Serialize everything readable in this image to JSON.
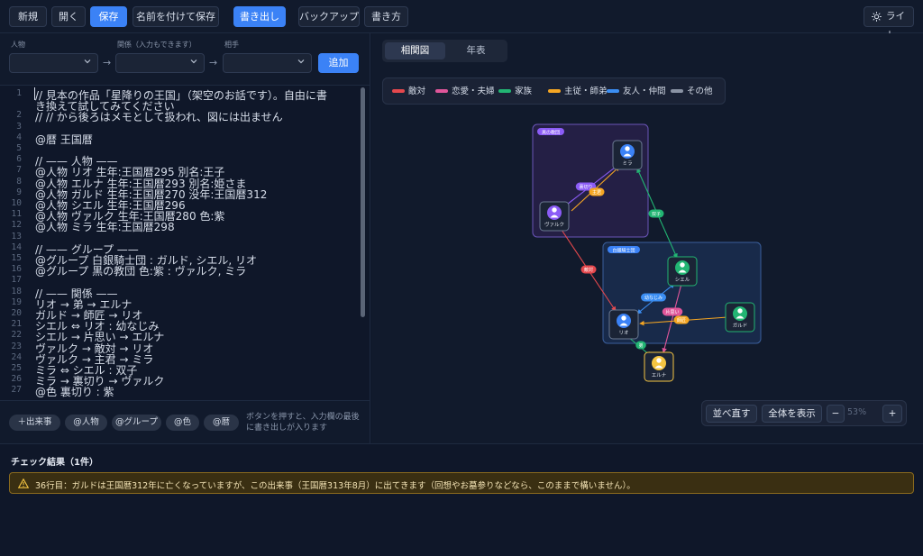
{
  "toolbar": {
    "new": "新規",
    "open": "開く",
    "save": "保存",
    "save_as": "名前を付けて保存",
    "export": "書き出し",
    "backup": "バックアップ",
    "syntax": "書き方",
    "theme": "ライト"
  },
  "form": {
    "person_label": "人物",
    "relation_label": "関係（入力もできます）",
    "partner_label": "相手",
    "add_button": "追加",
    "arrow": "→"
  },
  "editor": {
    "lines": [
      "// 見本の作品「星降りの王国」（架空のお話です）。自由に書",
      "き換えて試してみてください",
      "// // から後ろはメモとして扱われ、図には出ません",
      "",
      "@暦 王国暦",
      "",
      "// —— 人物 ——",
      "@人物 リオ 生年:王国暦295 別名:王子",
      "@人物 エルナ 生年:王国暦293 別名:姫さま",
      "@人物 ガルド 生年:王国暦270 没年:王国暦312",
      "@人物 シエル 生年:王国暦296",
      "@人物 ヴァルク 生年:王国暦280 色:紫",
      "@人物 ミラ 生年:王国暦298",
      "",
      "// —— グループ ——",
      "@グループ 白銀騎士団 : ガルド, シエル, リオ",
      "@グループ 黒の教団 色:紫 : ヴァルク, ミラ",
      "",
      "// —— 関係 ——",
      "リオ → 弟 → エルナ",
      "ガルド → 師匠 → リオ",
      "シエル ⇔ リオ : 幼なじみ",
      "シエル → 片思い → エルナ",
      "ヴァルク → 敵対 → リオ",
      "ヴァルク → 主君 → ミラ",
      "ミラ ⇔ シエル : 双子",
      "ミラ → 裏切り → ヴァルク",
      "@色 裏切り : 紫"
    ],
    "line_numbers": [
      "1",
      "",
      "2",
      "3",
      "4",
      "5",
      "6",
      "7",
      "8",
      "9",
      "10",
      "11",
      "12",
      "13",
      "14",
      "15",
      "16",
      "17",
      "18",
      "19",
      "20",
      "21",
      "22",
      "23",
      "24",
      "25",
      "26",
      "27",
      "28"
    ]
  },
  "snippets": {
    "event": "＋出来事",
    "person": "@人物",
    "group": "@グループ",
    "color": "@色",
    "calendar": "@暦",
    "hint": "ボタンを押すと、入力欄の最後に書き出しが入ります"
  },
  "view_tabs": {
    "diagram": "相関図",
    "timeline": "年表"
  },
  "legend": [
    {
      "label": "敵対",
      "color": "#e5484d"
    },
    {
      "label": "恋愛・夫婦",
      "color": "#e0569a"
    },
    {
      "label": "家族",
      "color": "#22b573"
    },
    {
      "label": "主従・師弟",
      "color": "#f5a623"
    },
    {
      "label": "友人・仲間",
      "color": "#3b8ef3"
    },
    {
      "label": "その他",
      "color": "#8a93a4"
    }
  ],
  "graph": {
    "groups": [
      {
        "label": "黒の教団",
        "color": "#8b5cf6"
      },
      {
        "label": "白銀騎士団",
        "color": "#3b82f6"
      }
    ],
    "nodes": [
      {
        "label": "ミラ",
        "avatar_color": "#3b82f6",
        "border": "#6b7a93"
      },
      {
        "label": "ヴァルク",
        "avatar_color": "#8b5cf6",
        "border": "#6b7a93"
      },
      {
        "label": "シエル",
        "avatar_color": "#22b573",
        "border": "#22b573"
      },
      {
        "label": "リオ",
        "avatar_color": "#3b82f6",
        "border": "#6b7a93"
      },
      {
        "label": "ガルド",
        "avatar_color": "#22b573",
        "border": "#22b573"
      },
      {
        "label": "エルナ",
        "avatar_color": "#f5c542",
        "border": "#f5c542"
      }
    ],
    "edge_labels": [
      {
        "text": "裏切り",
        "color": "#8b5cf6"
      },
      {
        "text": "主君",
        "color": "#f5a623"
      },
      {
        "text": "双子",
        "color": "#22b573"
      },
      {
        "text": "敵対",
        "color": "#e5484d"
      },
      {
        "text": "幼なじみ",
        "color": "#3b8ef3"
      },
      {
        "text": "片思い",
        "color": "#e0569a"
      },
      {
        "text": "師匠",
        "color": "#f5a623"
      },
      {
        "text": "弟",
        "color": "#22b573"
      }
    ]
  },
  "zoom": {
    "relayout": "並べ直す",
    "fit": "全体を表示",
    "minus": "−",
    "percent": "53%",
    "plus": "+"
  },
  "check": {
    "title": "チェック結果（1件）",
    "warning": "36行目：ガルドは王国暦312年に亡くなっていますが、この出来事（王国暦313年8月）に出てきます（回想やお墓参りなどなら、このままで構いません）。",
    "warning_color": "#f5c542"
  }
}
